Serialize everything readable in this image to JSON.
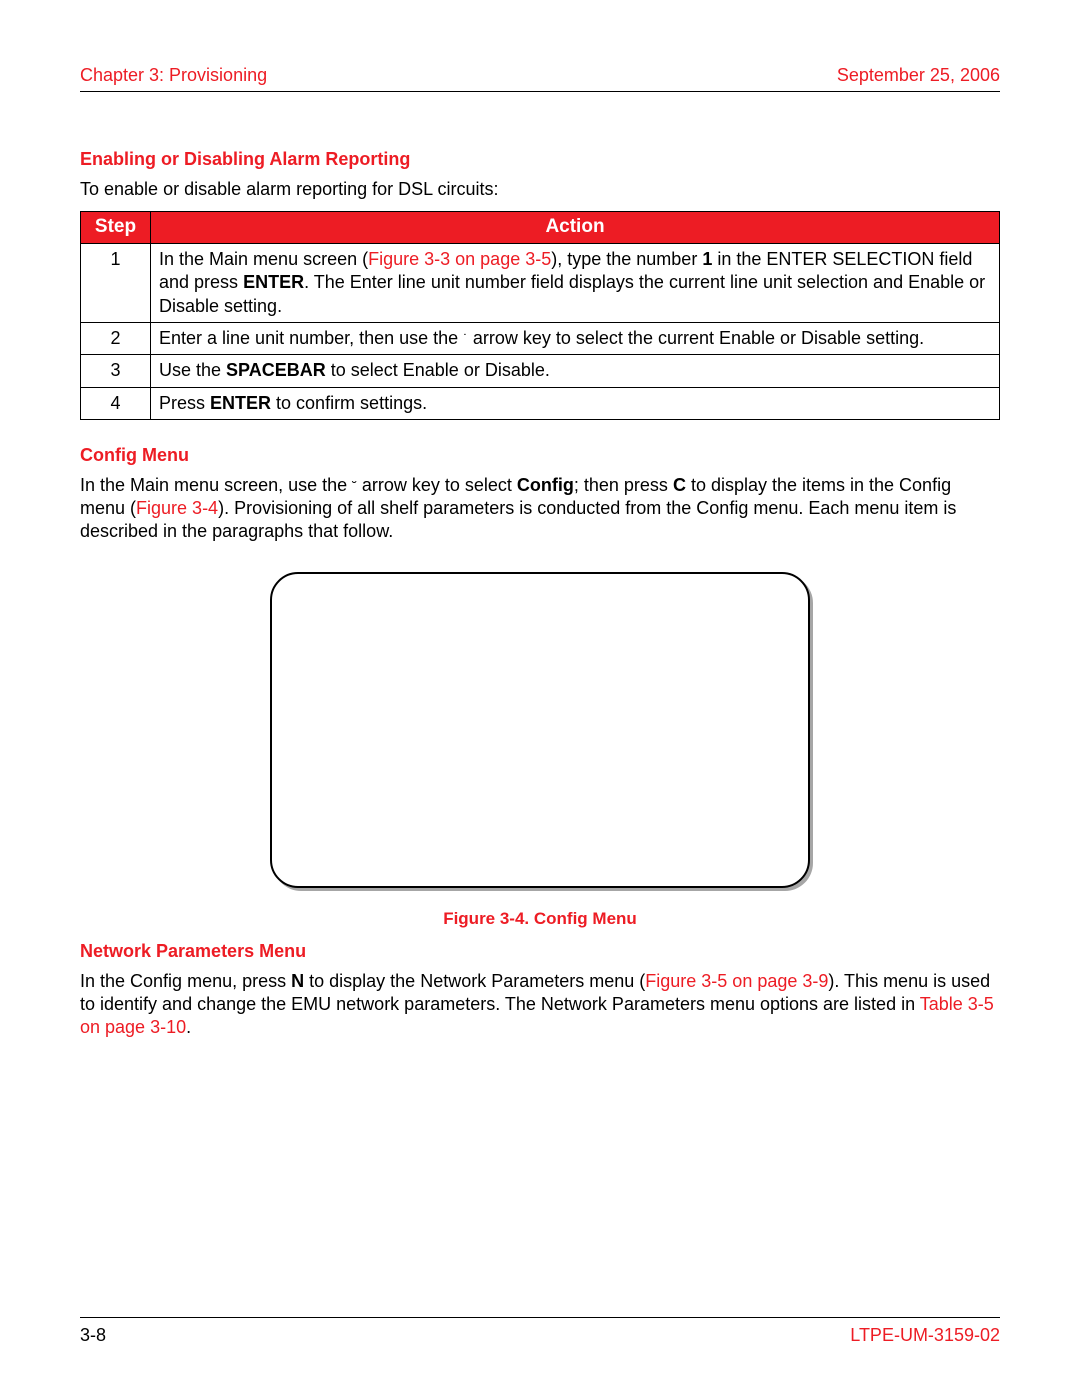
{
  "header": {
    "chapter": "Chapter 3: Provisioning",
    "date": "September 25, 2006"
  },
  "section1": {
    "title": "Enabling or Disabling Alarm Reporting",
    "intro": "To enable or disable alarm reporting for DSL circuits:"
  },
  "table": {
    "head_step": "Step",
    "head_action": "Action",
    "rows": [
      {
        "step": "1",
        "pre": "In the Main menu screen (",
        "link": "Figure 3-3 on page 3-5",
        "post1": "), type the number ",
        "bold1": "1",
        "post2": " in the ENTER SELECTION field and press ",
        "bold2": "ENTER",
        "post3": ". The Enter line unit number field displays the current line unit selection and Enable or Disable setting."
      },
      {
        "step": "2",
        "pre": "Enter a line unit number, then use the ",
        "arrow": "˙",
        "post": " arrow key to select the current Enable or Disable setting."
      },
      {
        "step": "3",
        "pre": "Use the ",
        "bold": "SPACEBAR",
        "post": " to select Enable or Disable."
      },
      {
        "step": "4",
        "pre": "Press ",
        "bold": "ENTER",
        "post": " to confirm settings."
      }
    ]
  },
  "section2": {
    "title": "Config Menu",
    "p1a": "In the Main menu screen, use the ",
    "arrow": "˘",
    "p1b": " arrow key to select ",
    "bold1": "Config",
    "p1c": "; then press ",
    "bold2": "C",
    "p1d": " to display the items in the Config menu (",
    "link": "Figure 3-4",
    "p1e": "). Provisioning of all shelf parameters is conducted from the Config menu. Each menu item is described in the paragraphs that follow."
  },
  "figure_caption": "Figure 3-4. Config Menu",
  "section3": {
    "title": "Network Parameters Menu",
    "p1a": "In the Config menu, press ",
    "bold1": "N",
    "p1b": " to display the Network Parameters menu (",
    "link1": "Figure 3-5 on page 3-9",
    "p1c": "). This menu is used to identify and change the EMU network parameters. The Network Parameters menu options are listed in ",
    "link2": "Table 3-5 on page 3-10",
    "p1d": "."
  },
  "footer": {
    "page": "3-8",
    "doc": "LTPE-UM-3159-02"
  }
}
